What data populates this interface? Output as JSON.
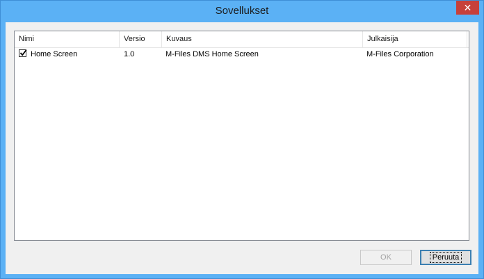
{
  "window": {
    "title": "Sovellukset",
    "close_label": "✕"
  },
  "list": {
    "columns": [
      "Nimi",
      "Versio",
      "Kuvaus",
      "Julkaisija"
    ],
    "rows": [
      {
        "checked": true,
        "name": "Home Screen",
        "version": "1.0",
        "description": "M-Files DMS Home Screen",
        "publisher": "M-Files Corporation"
      }
    ]
  },
  "buttons": {
    "ok": "OK",
    "cancel": "Peruuta"
  },
  "colors": {
    "window_frame": "#5bb1f5",
    "close_button": "#c7403a",
    "client_background": "#f0f0f0"
  }
}
